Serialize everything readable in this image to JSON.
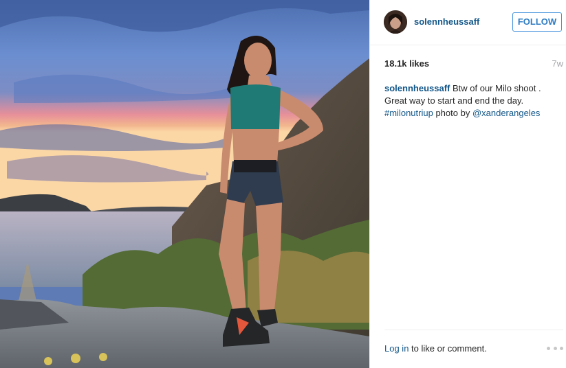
{
  "post": {
    "photo_alt": "",
    "username": "solennheussaff",
    "follow_label": "FOLLOW",
    "likes": "18.1k likes",
    "age": "7w",
    "caption": {
      "username": "solennheussaff",
      "text": " Btw of our Milo shoot . Great way to start and end the day. ",
      "hashtag": "#milonutriup",
      "middle": " photo by ",
      "mention": "@xanderangeles"
    },
    "footer": {
      "login_label": "Log in",
      "after_login": " to like or comment."
    }
  },
  "icons": {
    "avatar": "profile-avatar",
    "more": "more-options-icon"
  },
  "colors": {
    "link": "#125688",
    "follow_border": "#4090db",
    "follow_text": "#2f7cc4",
    "muted": "#a5a7aa"
  }
}
